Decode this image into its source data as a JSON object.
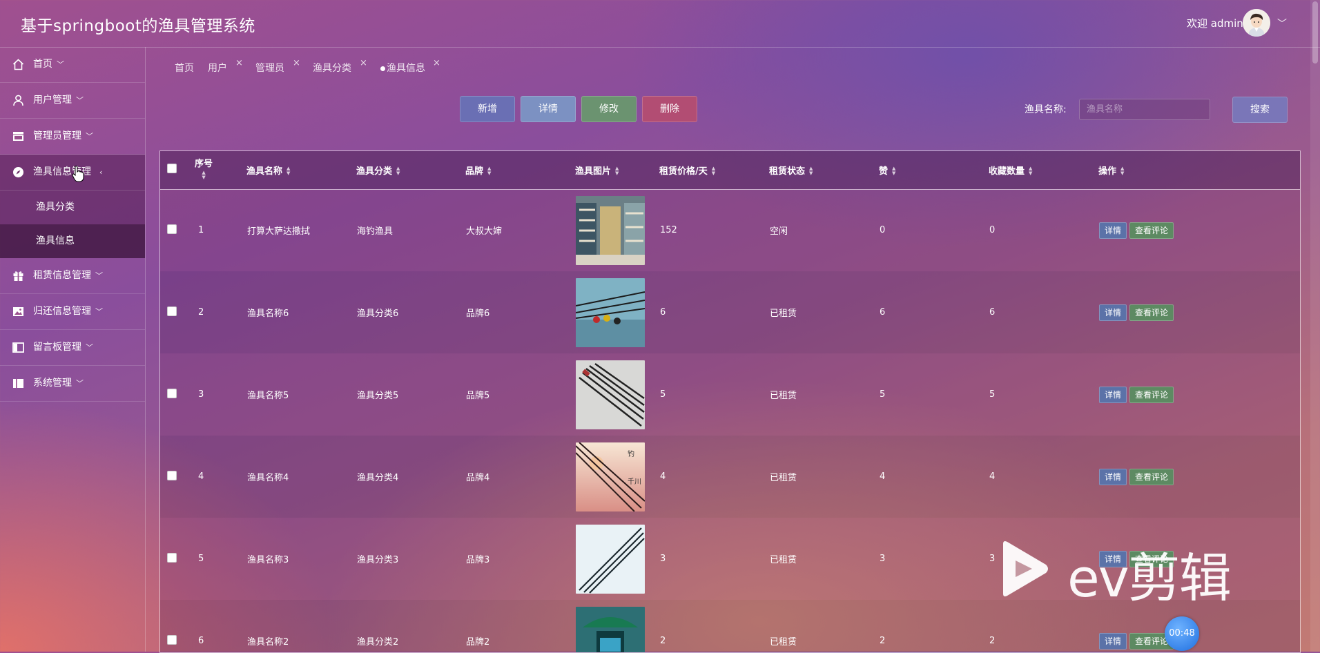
{
  "header": {
    "title": "基于springboot的渔具管理系统",
    "welcome": "欢迎 admin"
  },
  "sidebar": {
    "items": [
      {
        "label": "首页",
        "icon": "home-icon"
      },
      {
        "label": "用户管理",
        "icon": "user-icon"
      },
      {
        "label": "管理员管理",
        "icon": "shop-icon"
      },
      {
        "label": "渔具信息管理",
        "icon": "compass-icon",
        "sub": [
          "渔具分类",
          "渔具信息"
        ]
      },
      {
        "label": "租赁信息管理",
        "icon": "gift-icon"
      },
      {
        "label": "归还信息管理",
        "icon": "picture-icon"
      },
      {
        "label": "留言板管理",
        "icon": "panel-icon"
      },
      {
        "label": "系统管理",
        "icon": "book-icon"
      }
    ]
  },
  "tags": [
    "首页",
    "用户",
    "管理员",
    "渔具分类",
    "渔具信息"
  ],
  "toolbar": {
    "add": "新增",
    "detail": "详情",
    "edit": "修改",
    "delete": "删除"
  },
  "search": {
    "label": "渔具名称:",
    "placeholder": "渔具名称",
    "button": "搜索"
  },
  "table": {
    "headers": [
      "序号",
      "渔具名称",
      "渔具分类",
      "品牌",
      "渔具图片",
      "租赁价格/天",
      "租赁状态",
      "赞",
      "收藏数量",
      "操作"
    ],
    "row_buttons": {
      "detail": "详情",
      "comments": "查看评论"
    },
    "rows": [
      {
        "no": "1",
        "name": "打算大萨达撒拭",
        "category": "海钓渔具",
        "brand": "大叔大婶",
        "price": "152",
        "status": "空闲",
        "likes": "0",
        "favorites": "0"
      },
      {
        "no": "2",
        "name": "渔具名称6",
        "category": "渔具分类6",
        "brand": "品牌6",
        "price": "6",
        "status": "已租赁",
        "likes": "6",
        "favorites": "6"
      },
      {
        "no": "3",
        "name": "渔具名称5",
        "category": "渔具分类5",
        "brand": "品牌5",
        "price": "5",
        "status": "已租赁",
        "likes": "5",
        "favorites": "5"
      },
      {
        "no": "4",
        "name": "渔具名称4",
        "category": "渔具分类4",
        "brand": "品牌4",
        "price": "4",
        "status": "已租赁",
        "likes": "4",
        "favorites": "4"
      },
      {
        "no": "5",
        "name": "渔具名称3",
        "category": "渔具分类3",
        "brand": "品牌3",
        "price": "3",
        "status": "已租赁",
        "likes": "3",
        "favorites": "3"
      },
      {
        "no": "6",
        "name": "渔具名称2",
        "category": "渔具分类2",
        "brand": "品牌2",
        "price": "2",
        "status": "已租赁",
        "likes": "2",
        "favorites": "2"
      }
    ]
  },
  "watermark": {
    "text": "ev剪辑",
    "timer": "00:48"
  },
  "colors": {
    "add": "#6a6fb4",
    "detail": "#7c91c2",
    "edit": "#6b9370",
    "delete": "#b24d73",
    "search": "#7a76b8"
  }
}
